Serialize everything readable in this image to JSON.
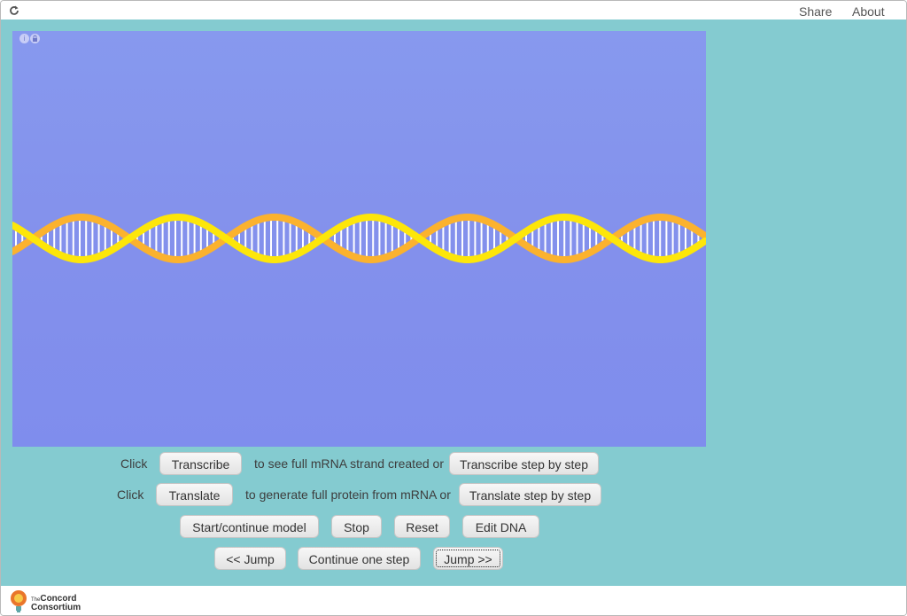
{
  "header": {
    "reload_icon": "reload-icon",
    "share_label": "Share",
    "about_label": "About"
  },
  "simulation": {
    "info_icon": "i",
    "lock_icon": "lock-icon",
    "strand_colors": [
      "#fde60a",
      "#fbb22e"
    ],
    "base_pair_color": "#ffffff"
  },
  "controls": {
    "row1": {
      "prefix": "Click",
      "transcribe_label": "Transcribe",
      "middle": "to see full mRNA strand created or",
      "step_label": "Transcribe step by step"
    },
    "row2": {
      "prefix": "Click",
      "translate_label": "Translate",
      "middle": "to generate full protein from mRNA or",
      "step_label": "Translate step by step"
    },
    "row3": {
      "start_label": "Start/continue model",
      "stop_label": "Stop",
      "reset_label": "Reset",
      "edit_label": "Edit DNA"
    },
    "row4": {
      "jump_back_label": "<< Jump",
      "continue_label": "Continue one step",
      "jump_forward_label": "Jump >>"
    }
  },
  "footer": {
    "logo_line1_prefix": "The",
    "logo_line1": "Concord",
    "logo_line2": "Consortium"
  },
  "colors": {
    "background": "#84cbd0",
    "simulation_bg": "#8394ee"
  }
}
